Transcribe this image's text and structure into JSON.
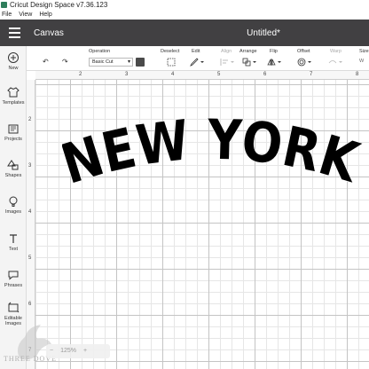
{
  "window": {
    "title": "Cricut Design Space  v7.36.123"
  },
  "menu": [
    "File",
    "View",
    "Help"
  ],
  "header": {
    "section": "Canvas",
    "document_title": "Untitled*"
  },
  "sidebar": {
    "items": [
      {
        "label": "New",
        "icon": "plus-circle-icon"
      },
      {
        "label": "Templates",
        "icon": "shirt-icon"
      },
      {
        "label": "Projects",
        "icon": "folder-icon"
      },
      {
        "label": "Shapes",
        "icon": "shapes-icon"
      },
      {
        "label": "Images",
        "icon": "lightbulb-icon"
      },
      {
        "label": "Text",
        "icon": "text-icon"
      },
      {
        "label": "Phrases",
        "icon": "speech-bubble-icon"
      },
      {
        "label": "Editable Images",
        "icon": "editable-images-icon"
      }
    ]
  },
  "toolbar": {
    "operation_label": "Operation",
    "operation_value": "Basic Cut",
    "deselect": "Deselect",
    "edit": "Edit",
    "align": "Align",
    "arrange": "Arrange",
    "flip": "Flip",
    "offset": "Offset",
    "warp": "Warp",
    "size": "Size",
    "swatch_color": "#4a4a4a"
  },
  "rulers": {
    "top": [
      "2",
      "3",
      "4",
      "5",
      "6",
      "7",
      "8"
    ],
    "left": [
      "2",
      "3",
      "4",
      "5",
      "6",
      "7"
    ]
  },
  "canvas": {
    "text": "NEW YORK",
    "fill_color": "#000000",
    "outline_color": "#ffffff"
  },
  "zoom": {
    "value": "125%"
  },
  "watermark": {
    "text": "THREE DOVE"
  }
}
